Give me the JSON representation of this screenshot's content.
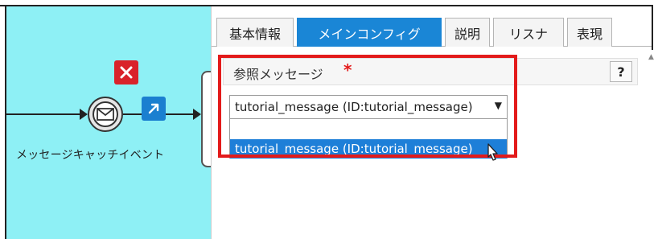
{
  "canvas": {
    "event_label": "メッセージキャッチイベント",
    "icons": {
      "delete": "close-icon",
      "connect": "arrow-up-right-icon",
      "event": "envelope-icon"
    }
  },
  "panel": {
    "tabs": [
      {
        "label": "基本情報",
        "active": false
      },
      {
        "label": "メインコンフィグ",
        "active": true
      },
      {
        "label": "説明",
        "active": false
      },
      {
        "label": "リスナ",
        "active": false
      },
      {
        "label": "表現",
        "active": false
      }
    ],
    "field": {
      "label": "参照メッセージ",
      "required_mark": "*",
      "help_label": "?",
      "select_value": "tutorial_message (ID:tutorial_message)",
      "caret": "▼",
      "options": [
        {
          "label": ""
        },
        {
          "label": "tutorial_message (ID:tutorial_message)"
        }
      ]
    }
  },
  "colors": {
    "lane": "#8ef0f5",
    "active_tab": "#1a86d6",
    "highlight_border": "#e31b1b",
    "selected_option": "#1e7fd8",
    "delete_button": "#d9222a",
    "connect_button": "#1a7fd0"
  }
}
